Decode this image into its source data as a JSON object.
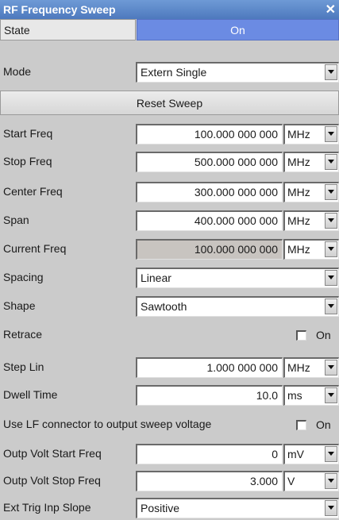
{
  "window": {
    "title": "RF Frequency Sweep",
    "close": "✕"
  },
  "state": {
    "label": "State",
    "value": "On"
  },
  "mode": {
    "label": "Mode",
    "value": "Extern Single"
  },
  "reset_button": "Reset Sweep",
  "start_freq": {
    "label": "Start Freq",
    "value": "100.000 000 000",
    "unit": "MHz"
  },
  "stop_freq": {
    "label": "Stop Freq",
    "value": "500.000 000 000",
    "unit": "MHz"
  },
  "center_freq": {
    "label": "Center Freq",
    "value": "300.000 000 000",
    "unit": "MHz"
  },
  "span": {
    "label": "Span",
    "value": "400.000 000 000",
    "unit": "MHz"
  },
  "current_freq": {
    "label": "Current Freq",
    "value": "100.000 000 000",
    "unit": "MHz"
  },
  "spacing": {
    "label": "Spacing",
    "value": "Linear"
  },
  "shape": {
    "label": "Shape",
    "value": "Sawtooth"
  },
  "retrace": {
    "label": "Retrace",
    "checkbox_label": "On"
  },
  "step_lin": {
    "label": "Step Lin",
    "value": "1.000 000 000",
    "unit": "MHz"
  },
  "dwell_time": {
    "label": "Dwell Time",
    "value": "10.0",
    "unit": "ms"
  },
  "lf_connector": {
    "label": "Use LF connector to output sweep voltage",
    "checkbox_label": "On"
  },
  "outp_volt_start": {
    "label": "Outp Volt Start Freq",
    "value": "0",
    "unit": "mV"
  },
  "outp_volt_stop": {
    "label": "Outp Volt Stop Freq",
    "value": "3.000",
    "unit": "V"
  },
  "ext_trig": {
    "label": "Ext Trig Inp Slope",
    "value": "Positive"
  }
}
